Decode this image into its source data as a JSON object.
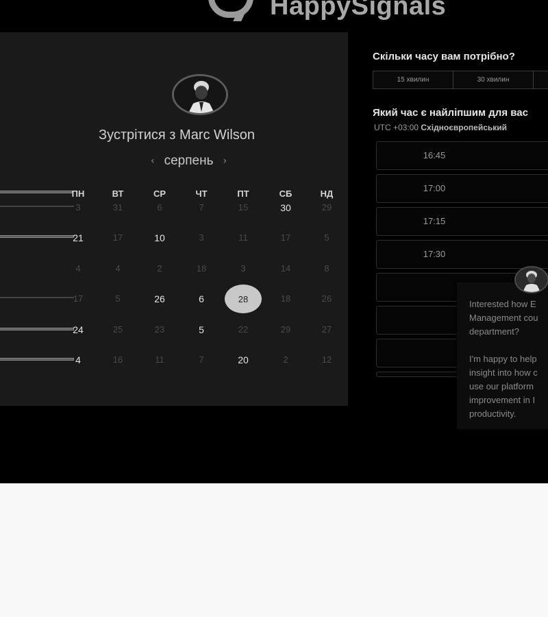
{
  "brand": {
    "name": "HappySignals"
  },
  "calendar": {
    "meet_title": "Зустрітися з Marc Wilson",
    "month": "серпень",
    "prev": "‹",
    "next": "›",
    "weekdays": [
      "ПН",
      "ВТ",
      "СР",
      "ЧТ",
      "ПТ",
      "СБ",
      "НД"
    ],
    "weeks": [
      [
        {
          "d": "3",
          "a": false
        },
        {
          "d": "31",
          "a": false
        },
        {
          "d": "6",
          "a": false
        },
        {
          "d": "7",
          "a": false
        },
        {
          "d": "15",
          "a": false
        },
        {
          "d": "30",
          "a": true
        },
        {
          "d": "29",
          "a": false
        }
      ],
      [
        {
          "d": "21",
          "a": true
        },
        {
          "d": "17",
          "a": false
        },
        {
          "d": "10",
          "a": true
        },
        {
          "d": "3",
          "a": false
        },
        {
          "d": "11",
          "a": false
        },
        {
          "d": "17",
          "a": false
        },
        {
          "d": "5",
          "a": false
        }
      ],
      [
        {
          "d": "4",
          "a": false
        },
        {
          "d": "4",
          "a": false
        },
        {
          "d": "2",
          "a": false
        },
        {
          "d": "18",
          "a": false
        },
        {
          "d": "3",
          "a": false
        },
        {
          "d": "14",
          "a": false
        },
        {
          "d": "8",
          "a": false
        }
      ],
      [
        {
          "d": "17",
          "a": false
        },
        {
          "d": "5",
          "a": false
        },
        {
          "d": "26",
          "a": true
        },
        {
          "d": "6",
          "a": true
        },
        {
          "d": "28",
          "a": true,
          "selected": true
        },
        {
          "d": "18",
          "a": false
        },
        {
          "d": "26",
          "a": false
        }
      ],
      [
        {
          "d": "24",
          "a": true
        },
        {
          "d": "25",
          "a": false
        },
        {
          "d": "23",
          "a": false
        },
        {
          "d": "5",
          "a": true
        },
        {
          "d": "22",
          "a": false
        },
        {
          "d": "29",
          "a": false
        },
        {
          "d": "27",
          "a": false
        }
      ],
      [
        {
          "d": "4",
          "a": true
        },
        {
          "d": "16",
          "a": false
        },
        {
          "d": "11",
          "a": false
        },
        {
          "d": "7",
          "a": false
        },
        {
          "d": "20",
          "a": true
        },
        {
          "d": "2",
          "a": false
        },
        {
          "d": "12",
          "a": false
        }
      ]
    ]
  },
  "booking": {
    "duration_question": "Скільки часу вам потрібно?",
    "durations": [
      "15 хвилин",
      "30 хвилин",
      ""
    ],
    "time_question": "Який час є найліпшим для вас",
    "timezone_prefix": "UTC +03:00",
    "timezone_name": "Східноєвропейський",
    "slots": [
      "16:45",
      "17:00",
      "17:15",
      "17:30",
      "",
      "",
      "",
      ""
    ]
  },
  "chat": {
    "message": "Interested how E\nManagement cou\ndepartment?\n\nI'm happy to help\ninsight into how c\nuse our platform\nimprovement in I\nproductivity."
  },
  "colors": {
    "top_bg": "#000000",
    "panel_bg": "#1a1a1a",
    "page_bg": "#f8f8f8",
    "selected_day": "#c8c8c8"
  }
}
